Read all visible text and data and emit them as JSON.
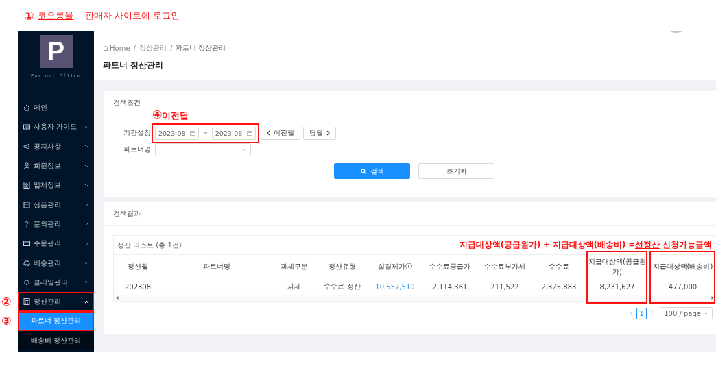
{
  "top_annotation": {
    "number": "①",
    "link": "코오롱몰",
    "text": "– 판매자 사이트에 로그인"
  },
  "sidebar": {
    "logo_letter": "P",
    "logo_subtitle": "Partner Office",
    "items": [
      {
        "label": "메인",
        "kind": "link",
        "selected": false
      },
      {
        "label": "사용자 가이드",
        "kind": "submenu",
        "expanded": false,
        "selected": false
      },
      {
        "label": "공지사항",
        "kind": "submenu",
        "expanded": false,
        "selected": false
      },
      {
        "label": "회원정보",
        "kind": "submenu",
        "expanded": false,
        "selected": false
      },
      {
        "label": "업체정보",
        "kind": "submenu",
        "expanded": false,
        "selected": false
      },
      {
        "label": "상품관리",
        "kind": "submenu",
        "expanded": false,
        "selected": false
      },
      {
        "label": "문의관리",
        "kind": "submenu",
        "expanded": false,
        "selected": false
      },
      {
        "label": "주문관리",
        "kind": "submenu",
        "expanded": false,
        "selected": false
      },
      {
        "label": "배송관리",
        "kind": "submenu",
        "expanded": false,
        "selected": false
      },
      {
        "label": "클레임관리",
        "kind": "submenu",
        "expanded": false,
        "selected": false
      },
      {
        "label": "정산관리",
        "kind": "submenu",
        "expanded": true,
        "selected": false,
        "highlighted": true,
        "annotation": "②",
        "children": [
          {
            "label": "파트너 정산관리",
            "selected": true,
            "highlighted": true,
            "annotation": "③"
          },
          {
            "label": "배송비 정산관리",
            "selected": false,
            "highlighted": false
          }
        ]
      }
    ]
  },
  "header": {
    "breadcrumb": [
      "Home",
      "정산관리",
      "파트너 정산관리"
    ],
    "breadcrumb_separator": "/",
    "title": "파트너 정산관리"
  },
  "search": {
    "title": "검색조건",
    "period_label": "기간설정",
    "from": "2023-08",
    "separator": "~",
    "to": "2023-08",
    "period_highlighted": true,
    "period_annotation": {
      "number": "④",
      "text": "이전달"
    },
    "prev_button": "이전월",
    "next_button": "당월",
    "partner_label": "파트너명",
    "search_button": "검색",
    "reset_button": "초기화"
  },
  "results": {
    "title": "검색결과",
    "list_title": "정산 리스트 (총 1건)",
    "formula_note": "지급대상액(공급원가) + 지급대상액(배송비) =**선정산** 신청가능금액",
    "columns": [
      {
        "label": "정산월",
        "kind": "text",
        "highlighted": false
      },
      {
        "label": "파트너명",
        "kind": "text",
        "highlighted": false
      },
      {
        "label": "과세구분",
        "kind": "text",
        "highlighted": false
      },
      {
        "label": "정산유형",
        "kind": "text",
        "highlighted": false
      },
      {
        "label": "실결제가ⓡ",
        "kind": "link",
        "highlighted": false
      },
      {
        "label": "수수료공급가",
        "kind": "text",
        "highlighted": false
      },
      {
        "label": "수수료부가세",
        "kind": "text",
        "highlighted": false
      },
      {
        "label": "수수료",
        "kind": "text",
        "highlighted": false
      },
      {
        "label": "지급대상액(공급원가)",
        "kind": "text",
        "highlighted": true
      },
      {
        "label": "지급대상액(배송비)",
        "kind": "text",
        "highlighted": true
      }
    ],
    "rows": [
      [
        "202308",
        null,
        "과세",
        "수수료 정산",
        "10,557,510",
        "2,114,361",
        "211,522",
        "2,325,883",
        "8,231,627",
        "477,000"
      ]
    ],
    "pages": [
      {
        "label": "1",
        "selected": true
      }
    ],
    "page_size": "100 / page"
  }
}
